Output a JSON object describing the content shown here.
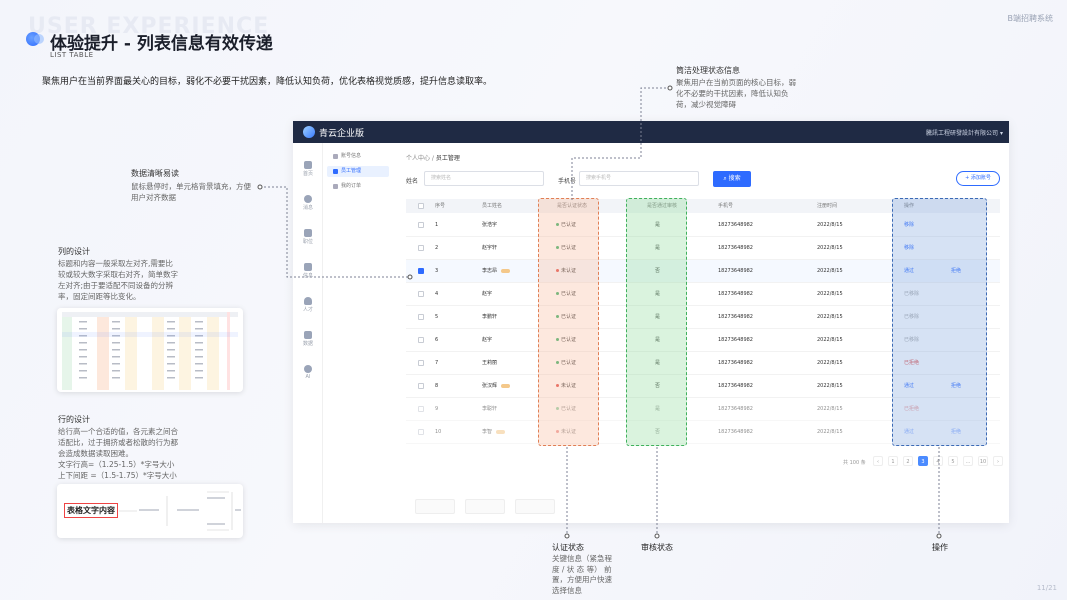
{
  "watermark": "USER EXPERIENCE",
  "brand": "B端招聘系统",
  "title": "体验提升 - 列表信息有效传递",
  "subtitle": "LIST TABLE",
  "lead": "聚焦用户在当前界面最关心的目标，弱化不必要干扰因素，降低认知负荷，优化表格视觉质感，提升信息读取率。",
  "notes": {
    "filter_title": "筒洁处理状态信息",
    "filter_text": [
      "聚焦用户在当前页面的核心目标，弱",
      "化不必要的干扰因素，降低认知负",
      "荷，减少视觉障碍"
    ],
    "readable_title": "数据清晰易读",
    "readable_text": [
      "鼠标悬停时，单元格背景填充，方便",
      "用户对齐数据"
    ],
    "column_title": "列的设计",
    "column_text": [
      "标题和内容一般采取左对齐,需要比",
      "较或较大数字采取右对齐，简单数字",
      "左对齐;由于要适配不同设备的分辨",
      "率，固定间距等比变化。"
    ],
    "row_title": "行的设计",
    "row_text": [
      "给行高一个合适的值，各元素之间合",
      "适配比，过于拥挤或者松散的行为都",
      "会造成数据读取困难。",
      "文字行高=（1.25-1.5）*字号大小",
      "上下间距 =（1.5-1.75）*字号大小"
    ],
    "row_sample": "表格文字内容",
    "cert_title": "认证状态",
    "cert_text": [
      "关键信息（紧急程",
      "度 / 状 态 等） 前",
      "置，方便用户快速",
      "选择信息"
    ],
    "audit_title": "审核状态",
    "op_title": "操作"
  },
  "app": {
    "name": "青云企业版",
    "company": "騰訊工程研發設計有限公司",
    "side_items": [
      "首页",
      "消息",
      "职位",
      "信息",
      "人才",
      "数据",
      "AI"
    ],
    "sub_items": [
      "账号信息",
      "员工管理",
      "我的订单"
    ],
    "crumb_parent": "个人中心",
    "crumb_current": "员工管理",
    "name_label": "姓名",
    "name_placeholder": "搜索姓名",
    "phone_label": "手机号",
    "phone_placeholder": "搜索手机号",
    "search_btn": "搜索",
    "add_btn": "+ 添加账号",
    "headers": [
      "序号",
      "员工姓名",
      "是否认证状态",
      "是否通过审核",
      "手机号",
      "注册时间",
      "操作"
    ],
    "rows": [
      {
        "no": "1",
        "name": "张浩宇",
        "tag": false,
        "cert": "已认证",
        "ok": true,
        "audit": "是",
        "phone": "18273648982",
        "date": "2022/8/15",
        "op1": "移除",
        "op1c": "blue",
        "op2": "",
        "sel": false,
        "fade": false
      },
      {
        "no": "2",
        "name": "赵宇轩",
        "tag": false,
        "cert": "已认证",
        "ok": true,
        "audit": "是",
        "phone": "18273648982",
        "date": "2022/8/15",
        "op1": "移除",
        "op1c": "blue",
        "op2": "",
        "sel": false,
        "fade": false
      },
      {
        "no": "3",
        "name": "李志昂",
        "tag": true,
        "cert": "未认证",
        "ok": false,
        "audit": "否",
        "phone": "18273648982",
        "date": "2022/8/15",
        "op1": "通过",
        "op1c": "blue",
        "op2": "拒绝",
        "sel": true,
        "fade": false
      },
      {
        "no": "4",
        "name": "赵宇",
        "tag": false,
        "cert": "已认证",
        "ok": true,
        "audit": "是",
        "phone": "18273648982",
        "date": "2022/8/15",
        "op1": "已移除",
        "op1c": "gray",
        "op2": "",
        "sel": false,
        "fade": false
      },
      {
        "no": "5",
        "name": "李鹏轩",
        "tag": false,
        "cert": "已认证",
        "ok": true,
        "audit": "是",
        "phone": "18273648982",
        "date": "2022/8/15",
        "op1": "已移除",
        "op1c": "gray",
        "op2": "",
        "sel": false,
        "fade": false
      },
      {
        "no": "6",
        "name": "赵宇",
        "tag": false,
        "cert": "已认证",
        "ok": true,
        "audit": "是",
        "phone": "18273648982",
        "date": "2022/8/15",
        "op1": "已移除",
        "op1c": "gray",
        "op2": "",
        "sel": false,
        "fade": false
      },
      {
        "no": "7",
        "name": "王莉丽",
        "tag": false,
        "cert": "已认证",
        "ok": true,
        "audit": "是",
        "phone": "18273648982",
        "date": "2022/8/15",
        "op1": "已拒绝",
        "op1c": "red",
        "op2": "",
        "sel": false,
        "fade": false
      },
      {
        "no": "8",
        "name": "张汉辉",
        "tag": true,
        "cert": "未认证",
        "ok": false,
        "audit": "否",
        "phone": "18273648982",
        "date": "2022/8/15",
        "op1": "通过",
        "op1c": "blue",
        "op2": "拒绝",
        "sel": false,
        "fade": false
      },
      {
        "no": "9",
        "name": "李聪轩",
        "tag": false,
        "cert": "已认证",
        "ok": true,
        "audit": "是",
        "phone": "18273648982",
        "date": "2022/8/15",
        "op1": "已拒绝",
        "op1c": "red",
        "op2": "",
        "sel": false,
        "fade": true
      },
      {
        "no": "10",
        "name": "李智",
        "tag": true,
        "cert": "未认证",
        "ok": false,
        "audit": "否",
        "phone": "18273648982",
        "date": "2022/8/15",
        "op1": "通过",
        "op1c": "blue",
        "op2": "拒绝",
        "sel": false,
        "fade": true
      }
    ],
    "total": "共 100 条",
    "pages": [
      "‹",
      "1",
      "2",
      "3",
      "4",
      "5",
      "…",
      "10",
      "›"
    ],
    "current_page": "3"
  },
  "page_number": "11/21"
}
